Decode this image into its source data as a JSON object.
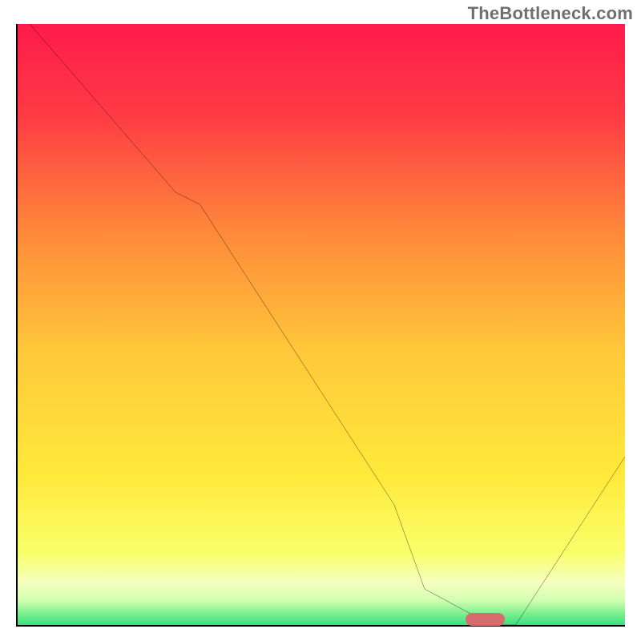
{
  "watermark": "TheBottleneck.com",
  "chart_data": {
    "type": "line",
    "title": "",
    "xlabel": "",
    "ylabel": "",
    "xlim": [
      0,
      100
    ],
    "ylim": [
      0,
      100
    ],
    "x": [
      2,
      26,
      30,
      62,
      67,
      78,
      82,
      100
    ],
    "values": [
      100,
      72,
      70,
      20,
      6,
      0,
      0,
      28
    ],
    "marker": {
      "x": 77,
      "y": 1,
      "width_pct": 6.5,
      "color": "#d86b6b"
    },
    "background_gradient": {
      "stops": [
        {
          "pos": 0.0,
          "color": "#ff1a4b"
        },
        {
          "pos": 0.15,
          "color": "#ff3a44"
        },
        {
          "pos": 0.35,
          "color": "#ff8a3a"
        },
        {
          "pos": 0.55,
          "color": "#ffc93a"
        },
        {
          "pos": 0.75,
          "color": "#ffe93a"
        },
        {
          "pos": 0.88,
          "color": "#f9ff6a"
        },
        {
          "pos": 0.93,
          "color": "#f5ffc0"
        },
        {
          "pos": 0.96,
          "color": "#d0ffb0"
        },
        {
          "pos": 0.98,
          "color": "#80f090"
        },
        {
          "pos": 1.0,
          "color": "#38e080"
        }
      ]
    }
  }
}
